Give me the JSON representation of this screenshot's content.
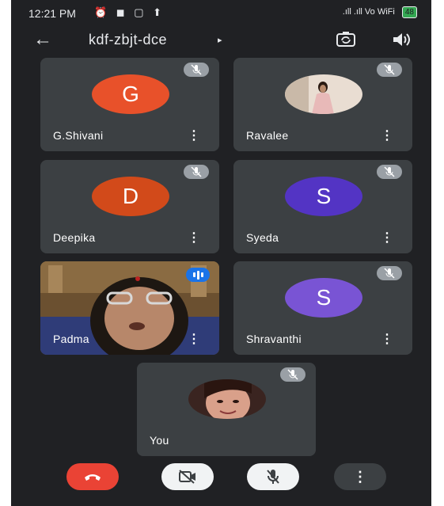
{
  "status_bar": {
    "time": "12:21 PM",
    "icons": "⏰ ◼ ▢ ⬆",
    "network": ".ıll .ıll Vo WiFi",
    "battery": "48"
  },
  "header": {
    "meeting_code": "kdf-zbjt-dce",
    "caret": "▸"
  },
  "participants": [
    {
      "name": "G.Shivani",
      "initial": "G",
      "avatar_color": "#e8512a",
      "muted": true
    },
    {
      "name": "Ravalee",
      "initial": "",
      "avatar_color": "#d9c7b9",
      "muted": true
    },
    {
      "name": "Deepika",
      "initial": "D",
      "avatar_color": "#d24a1a",
      "muted": true
    },
    {
      "name": "Syeda",
      "initial": "S",
      "avatar_color": "#5334c4",
      "muted": true
    },
    {
      "name": "Padma",
      "initial": "",
      "avatar_color": "",
      "muted": false,
      "speaking": true
    },
    {
      "name": "Shravanthi",
      "initial": "S",
      "avatar_color": "#7954d4",
      "muted": true
    },
    {
      "name": "You",
      "initial": "",
      "avatar_color": "#c98f7a",
      "muted": true
    }
  ],
  "controls": {
    "end_call_color": "#ea4335",
    "camera_off": true,
    "mic_off": true
  }
}
